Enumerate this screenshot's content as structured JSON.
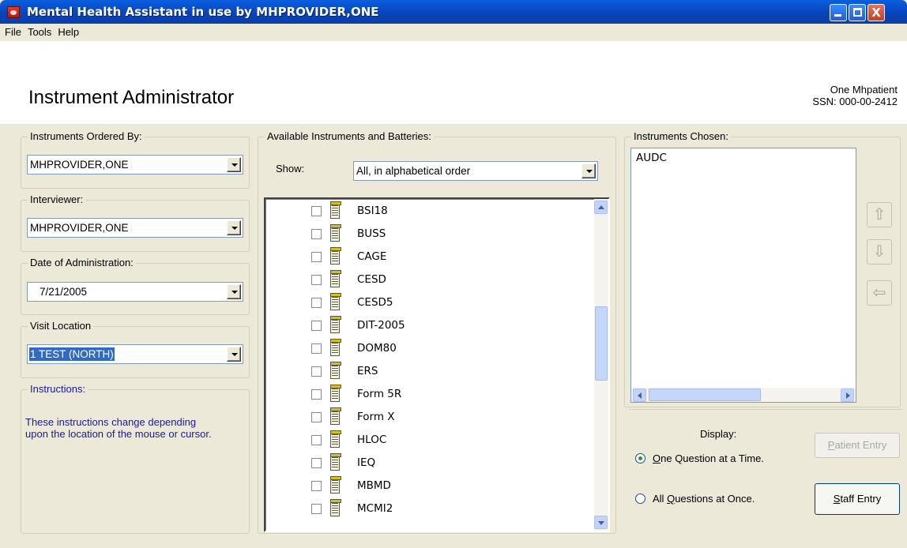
{
  "window": {
    "title": "Mental Health Assistant in use by MHPROVIDER,ONE",
    "buttons": {
      "minimize": "minimize",
      "maximize": "maximize",
      "close": "X"
    }
  },
  "menu": [
    "File",
    "Tools",
    "Help"
  ],
  "header": {
    "title": "Instrument Administrator",
    "patient_name": "One Mhpatient",
    "ssn": "SSN: 000-00-2412"
  },
  "left": {
    "ordered_by": {
      "label": "Instruments Ordered By:",
      "value": "MHPROVIDER,ONE"
    },
    "interviewer": {
      "label": "Interviewer:",
      "value": "MHPROVIDER,ONE"
    },
    "date": {
      "label": "Date of Administration:",
      "value": "7/21/2005"
    },
    "location": {
      "label": "Visit Location",
      "value": "1 TEST (NORTH)"
    },
    "instructions": {
      "label": "Instructions:",
      "text": "These instructions change depending upon the location of the mouse or cursor."
    }
  },
  "available": {
    "label": "Available Instruments and Batteries:",
    "show_label": "Show:",
    "show_value": "All, in alphabetical order",
    "items": [
      "BSI18",
      "BUSS",
      "CAGE",
      "CESD",
      "CESD5",
      "DIT-2005",
      "DOM80",
      "ERS",
      "Form 5R",
      "Form X",
      "HLOC",
      "IEQ",
      "MBMD",
      "MCMI2"
    ]
  },
  "chosen": {
    "label": "Instruments Chosen:",
    "items": [
      "AUDC"
    ]
  },
  "move_buttons": {
    "up": "⇧",
    "down": "⇩",
    "remove": "⇦"
  },
  "display": {
    "label": "Display:",
    "one_at_a_time": "One Question at a Time.",
    "all_at_once": "All Questions at Once.",
    "selected": "one_at_a_time"
  },
  "buttons": {
    "patient_entry": "Patient Entry",
    "staff_entry": "Staff Entry"
  },
  "colors": {
    "titlebar": "#0a5fe0",
    "instructions_text": "#1a1a9a",
    "selection": "#316ac5"
  }
}
